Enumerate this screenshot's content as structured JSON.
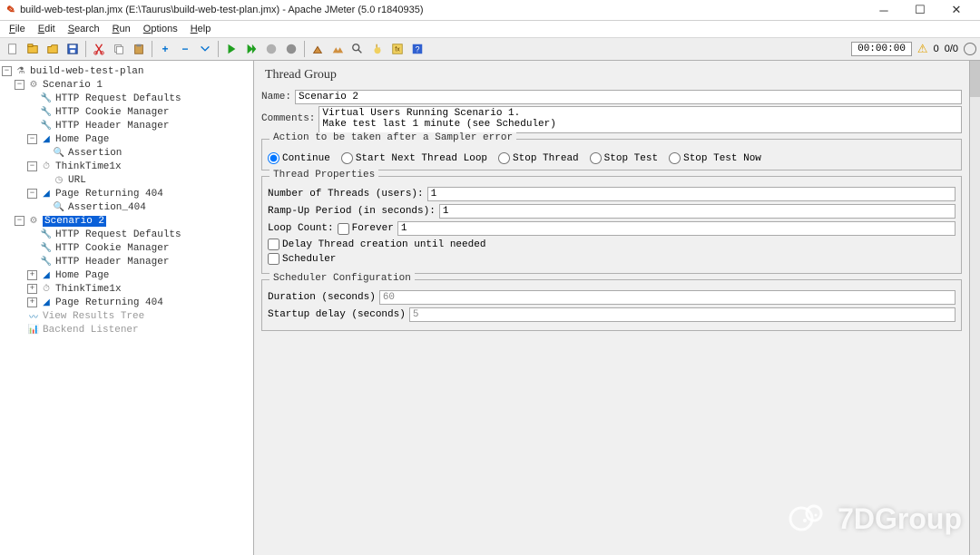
{
  "window": {
    "title": "build-web-test-plan.jmx (E:\\Taurus\\build-web-test-plan.jmx) - Apache JMeter (5.0 r1840935)"
  },
  "menus": {
    "file": "File",
    "edit": "Edit",
    "search": "Search",
    "run": "Run",
    "options": "Options",
    "help": "Help"
  },
  "toolbar_status": {
    "timer": "00:00:00",
    "warn_count": "0",
    "threads": "0/0"
  },
  "tree": {
    "root": "build-web-test-plan",
    "s1": "Scenario 1",
    "s1_req_defaults": "HTTP Request Defaults",
    "s1_cookie": "HTTP Cookie Manager",
    "s1_header": "HTTP Header Manager",
    "s1_home": "Home Page",
    "s1_assertion": "Assertion",
    "s1_think": "ThinkTime1x",
    "s1_url": "URL",
    "s1_404": "Page Returning 404",
    "s1_assert404": "Assertion_404",
    "s2": "Scenario 2",
    "s2_req_defaults": "HTTP Request Defaults",
    "s2_cookie": "HTTP Cookie Manager",
    "s2_header": "HTTP Header Manager",
    "s2_home": "Home Page",
    "s2_think": "ThinkTime1x",
    "s2_404": "Page Returning 404",
    "view_results": "View Results Tree",
    "backend": "Backend Listener"
  },
  "editor": {
    "panel_title": "Thread Group",
    "name_label": "Name:",
    "name_value": "Scenario 2",
    "comments_label": "Comments:",
    "comments_value": "Virtual Users Running Scenario 1.\nMake test last 1 minute (see Scheduler)",
    "sampler_error": {
      "legend": "Action to be taken after a Sampler error",
      "continue": "Continue",
      "start_next": "Start Next Thread Loop",
      "stop_thread": "Stop Thread",
      "stop_test": "Stop Test",
      "stop_now": "Stop Test Now"
    },
    "thread_props": {
      "legend": "Thread Properties",
      "num_threads_label": "Number of Threads (users):",
      "num_threads_value": "1",
      "ramp_label": "Ramp-Up Period (in seconds):",
      "ramp_value": "1",
      "loop_label": "Loop Count:",
      "forever": "Forever",
      "loop_value": "1",
      "delay_creation": "Delay Thread creation until needed",
      "scheduler": "Scheduler"
    },
    "scheduler_cfg": {
      "legend": "Scheduler Configuration",
      "duration_label": "Duration (seconds)",
      "duration_value": "60",
      "startup_label": "Startup delay (seconds)",
      "startup_value": "5"
    }
  },
  "watermark": "7DGroup"
}
